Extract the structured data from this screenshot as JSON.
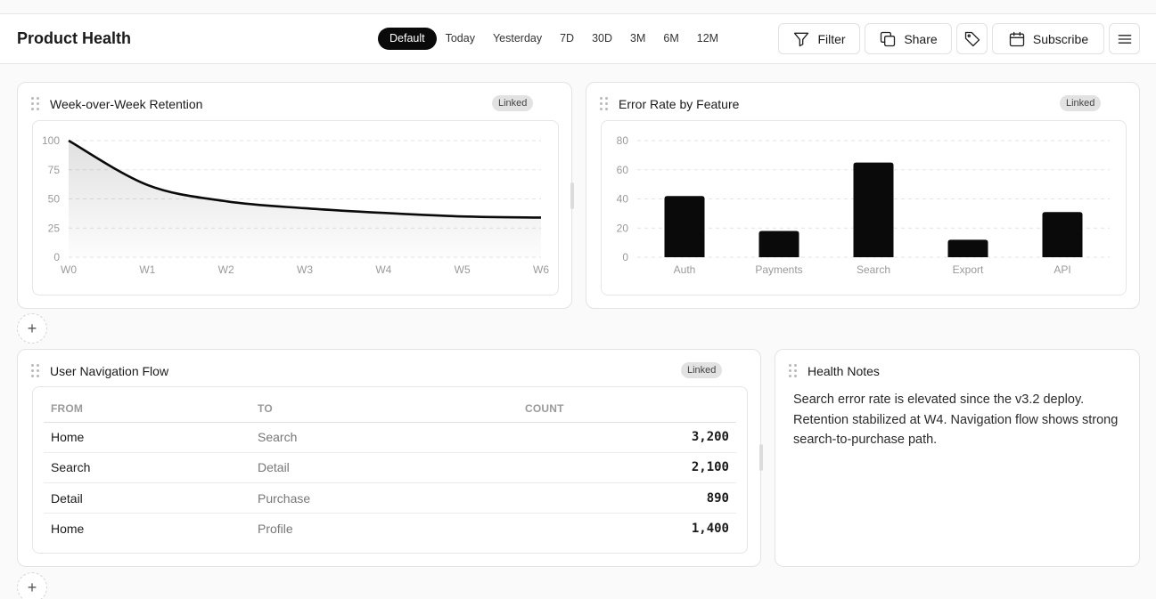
{
  "header": {
    "title": "Product Health",
    "ranges": [
      "Default",
      "Today",
      "Yesterday",
      "7D",
      "30D",
      "3M",
      "6M",
      "12M"
    ],
    "active_range": "Default",
    "filter_label": "Filter",
    "share_label": "Share",
    "subscribe_label": "Subscribe"
  },
  "retention": {
    "title": "Week-over-Week Retention",
    "badge": "Linked"
  },
  "errors": {
    "title": "Error Rate by Feature",
    "badge": "Linked"
  },
  "flow": {
    "title": "User Navigation Flow",
    "badge": "Linked",
    "columns": [
      "FROM",
      "TO",
      "COUNT"
    ],
    "rows": [
      {
        "from": "Home",
        "to": "Search",
        "count": "3,200"
      },
      {
        "from": "Search",
        "to": "Detail",
        "count": "2,100"
      },
      {
        "from": "Detail",
        "to": "Purchase",
        "count": "890"
      },
      {
        "from": "Home",
        "to": "Profile",
        "count": "1,400"
      }
    ]
  },
  "notes": {
    "title": "Health Notes",
    "body": "Search error rate is elevated since the v3.2 deploy. Retention stabilized at W4. Navigation flow shows strong search-to-purchase path."
  },
  "chart_data": [
    {
      "type": "area",
      "title": "Week-over-Week Retention",
      "x": [
        "W0",
        "W1",
        "W2",
        "W3",
        "W4",
        "W5",
        "W6"
      ],
      "values": [
        100,
        62,
        48,
        42,
        38,
        35,
        34
      ],
      "yticks": [
        0,
        25,
        50,
        75,
        100
      ],
      "ylim": [
        0,
        100
      ],
      "grid": true,
      "color": "#0a0a0a"
    },
    {
      "type": "bar",
      "title": "Error Rate by Feature",
      "categories": [
        "Auth",
        "Payments",
        "Search",
        "Export",
        "API"
      ],
      "values": [
        42,
        18,
        65,
        12,
        31
      ],
      "yticks": [
        0,
        20,
        40,
        60,
        80
      ],
      "ylim": [
        0,
        80
      ],
      "grid": true,
      "color": "#0a0a0a"
    }
  ]
}
